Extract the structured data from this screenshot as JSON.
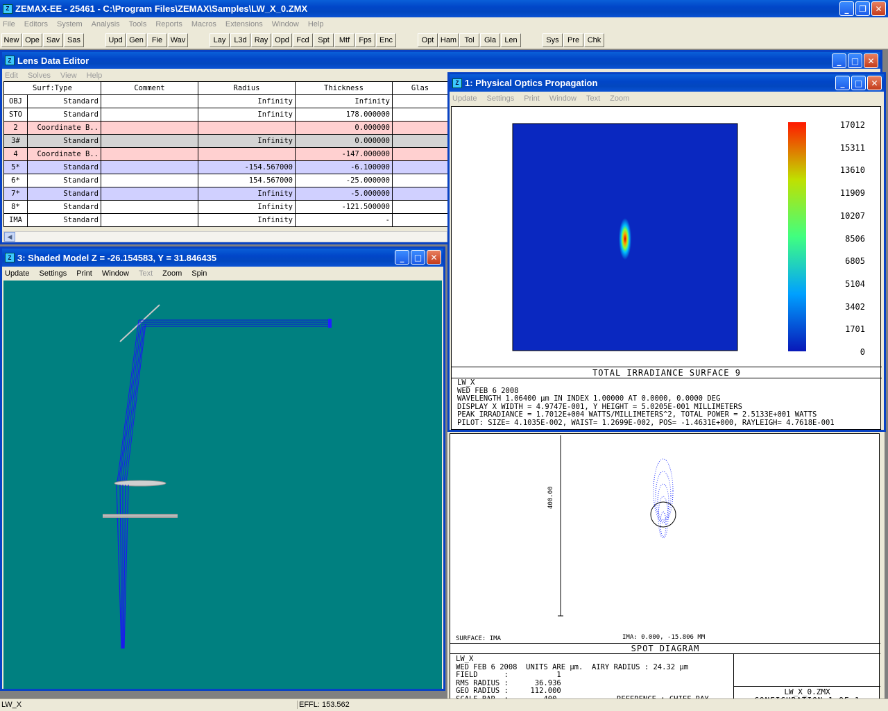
{
  "app": {
    "title": "ZEMAX-EE - 25461 - C:\\Program Files\\ZEMAX\\Samples\\LW_X_0.ZMX",
    "icon": "zemax-app-icon"
  },
  "menu": [
    "File",
    "Editors",
    "System",
    "Analysis",
    "Tools",
    "Reports",
    "Macros",
    "Extensions",
    "Window",
    "Help"
  ],
  "toolbar": [
    "New",
    "Ope",
    "Sav",
    "Sas",
    "Upd",
    "Gen",
    "Fie",
    "Wav",
    "Lay",
    "L3d",
    "Ray",
    "Opd",
    "Fcd",
    "Spt",
    "Mtf",
    "Fps",
    "Enc",
    "Opt",
    "Ham",
    "Tol",
    "Gla",
    "Len",
    "Sys",
    "Pre",
    "Chk"
  ],
  "lde": {
    "title": "Lens Data Editor",
    "menu": [
      "Edit",
      "Solves",
      "View",
      "Help"
    ],
    "headers": [
      "Surf:Type",
      "Comment",
      "Radius",
      "Thickness",
      "Glas"
    ],
    "rows": [
      {
        "surf": "OBJ",
        "type": "Standard",
        "comment": "",
        "radius": "Infinity",
        "thickness": "Infinity",
        "style": ""
      },
      {
        "surf": "STO",
        "type": "Standard",
        "comment": "",
        "radius": "Infinity",
        "thickness": "178.000000",
        "style": ""
      },
      {
        "surf": "2",
        "type": "Coordinate B..",
        "comment": "",
        "radius": "",
        "thickness": "0.000000",
        "style": "pink"
      },
      {
        "surf": "3#",
        "type": "Standard",
        "comment": "",
        "radius": "Infinity",
        "thickness": "0.000000",
        "style": "gray"
      },
      {
        "surf": "4",
        "type": "Coordinate B..",
        "comment": "",
        "radius": "",
        "thickness": "-147.000000",
        "style": "pink"
      },
      {
        "surf": "5*",
        "type": "Standard",
        "comment": "",
        "radius": "-154.567000",
        "thickness": "-6.100000",
        "style": "blue"
      },
      {
        "surf": "6*",
        "type": "Standard",
        "comment": "",
        "radius": "154.567000",
        "thickness": "-25.000000",
        "style": ""
      },
      {
        "surf": "7*",
        "type": "Standard",
        "comment": "",
        "radius": "Infinity",
        "thickness": "-5.000000",
        "style": "blue"
      },
      {
        "surf": "8*",
        "type": "Standard",
        "comment": "",
        "radius": "Infinity",
        "thickness": "-121.500000",
        "style": ""
      },
      {
        "surf": "IMA",
        "type": "Standard",
        "comment": "",
        "radius": "Infinity",
        "thickness": "-",
        "style": ""
      }
    ]
  },
  "shaded": {
    "title": "3: Shaded Model Z = -26.154583, Y = 31.846435",
    "menu": [
      "Update",
      "Settings",
      "Print",
      "Window",
      "Text",
      "Zoom",
      "Spin"
    ],
    "menu_dim": [
      false,
      false,
      false,
      false,
      true,
      false,
      false
    ],
    "bg_color": "#008080"
  },
  "pop": {
    "title": "1: Physical Optics Propagation",
    "menu": [
      "Update",
      "Settings",
      "Print",
      "Window",
      "Text",
      "Zoom"
    ],
    "colorbar_labels": [
      "17012",
      "15311",
      "13610",
      "11909",
      "10207",
      "8506",
      "6805",
      "5104",
      "3402",
      "1701",
      "0"
    ],
    "plot_title": "TOTAL IRRADIANCE SURFACE 9",
    "info": [
      "LW_X",
      "WED FEB 6 2008",
      "WAVELENGTH 1.06400 µm IN INDEX 1.00000 AT 0.0000, 0.0000 DEG",
      "DISPLAY X WIDTH = 4.9747E-001, Y HEIGHT = 5.0205E-001 MILLIMETERS",
      "PEAK IRRADIANCE = 1.7012E+004 WATTS/MILLIMETERS^2, TOTAL POWER = 2.5133E+001 WATTS",
      "PILOT: SIZE= 4.1035E-002, WAIST= 1.2699E-002, POS= -1.4631E+000, RAYLEIGH= 4.7618E-001"
    ]
  },
  "spot": {
    "scale_label": "400.00",
    "surface_label": "SURFACE: IMA",
    "ima_label": "IMA: 0.000, -15.806 MM",
    "title": "SPOT DIAGRAM",
    "info_left": [
      "LW_X",
      "WED FEB 6 2008  UNITS ARE µm.  AIRY RADIUS : 24.32 µm",
      "FIELD      :           1",
      "RMS RADIUS :      36.936",
      "GEO RADIUS :     112.000",
      "SCALE BAR  :        400"
    ],
    "reference": "REFERENCE  : CHIEF RAY",
    "file": "LW_X_0.ZMX",
    "config": "CONFIGURATION 1 OF 1"
  },
  "status": {
    "left": "LW_X",
    "effl": "EFFL: 153.562"
  }
}
